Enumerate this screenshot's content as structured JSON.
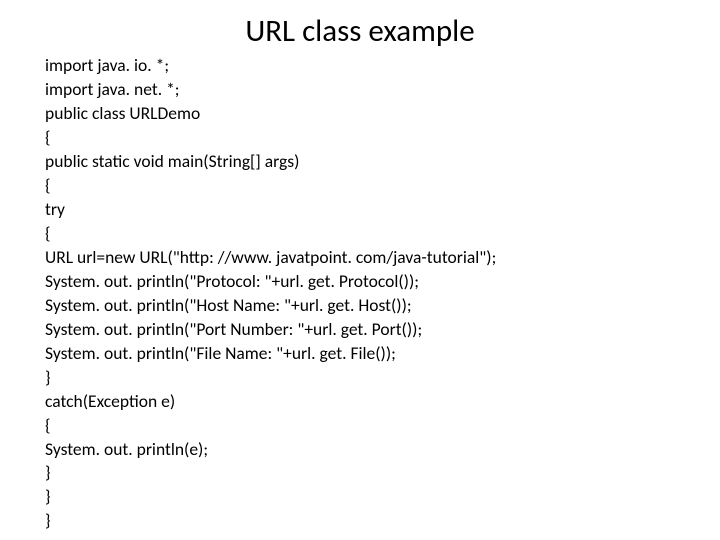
{
  "title": "URL class example",
  "code": {
    "line1": "import java. io. *;",
    "line2": "import java. net. *;",
    "line3": "public class URLDemo",
    "line4": "{",
    "line5": "public static void main(String[] args)",
    "line6": "{",
    "line7": "try",
    "line8": "{",
    "line9": "URL url=new URL(\"http: //www. javatpoint. com/java-tutorial\");",
    "line10": "System. out. println(\"Protocol: \"+url. get. Protocol());",
    "line11": "System. out. println(\"Host Name: \"+url. get. Host());",
    "line12": "System. out. println(\"Port Number: \"+url. get. Port());",
    "line13": "System. out. println(\"File Name: \"+url. get. File());",
    "line14": "}",
    "line15": "catch(Exception e)",
    "line16": "{",
    "line17": "System. out. println(e);",
    "line18": "}",
    "line19": "}",
    "line20": "}"
  }
}
